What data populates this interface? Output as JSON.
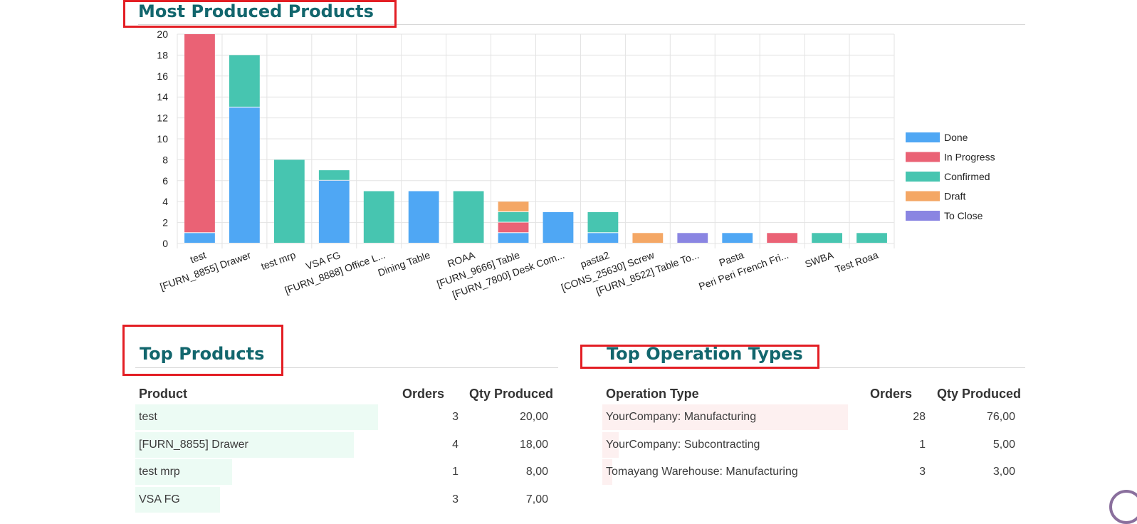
{
  "sections": {
    "most_produced": {
      "title": "Most Produced Products"
    },
    "top_products": {
      "title": "Top Products"
    },
    "top_operation_types": {
      "title": "Top Operation Types"
    }
  },
  "colors": {
    "title": "#12666d",
    "annotation_box": "#e31e24",
    "Done": "#4fa7f4",
    "In Progress": "#ea6275",
    "Confirmed": "#47c5b0",
    "Draft": "#f4a765",
    "To Close": "#8a85e2",
    "product_bar_bg": "#ecfbf4",
    "operation_bar_bg": "#fdf0f0"
  },
  "chart_data": {
    "type": "bar",
    "stacked": true,
    "title": "",
    "xlabel": "",
    "ylabel": "",
    "ylim": [
      0,
      20
    ],
    "y_ticks": [
      0,
      2,
      4,
      6,
      8,
      10,
      12,
      14,
      16,
      18,
      20
    ],
    "grid": true,
    "legend_position": "right",
    "categories": [
      "test",
      "[FURN_8855] Drawer",
      "test mrp",
      "VSA FG",
      "[FURN_8888] Office L...",
      "Dining Table",
      "ROAA",
      "[FURN_9666] Table",
      "[FURN_7800] Desk Com...",
      "pasta2",
      "[CONS_25630] Screw",
      "[FURN_8522] Table To...",
      "Pasta",
      "Peri Peri French Fri...",
      "SWBA",
      "Test Roaa"
    ],
    "series": [
      {
        "name": "Done",
        "values": [
          1,
          13,
          0,
          6,
          0,
          5,
          0,
          1,
          3,
          1,
          0,
          0,
          1,
          0,
          0,
          0
        ]
      },
      {
        "name": "In Progress",
        "values": [
          19,
          0,
          0,
          0,
          0,
          0,
          0,
          1,
          0,
          0,
          0,
          0,
          0,
          1,
          0,
          0
        ]
      },
      {
        "name": "Confirmed",
        "values": [
          0,
          5,
          8,
          1,
          5,
          0,
          5,
          1,
          0,
          2,
          0,
          0,
          0,
          0,
          1,
          1
        ]
      },
      {
        "name": "Draft",
        "values": [
          0,
          0,
          0,
          0,
          0,
          0,
          0,
          1,
          0,
          0,
          1,
          0,
          0,
          0,
          0,
          0
        ]
      },
      {
        "name": "To Close",
        "values": [
          0,
          0,
          0,
          0,
          0,
          0,
          0,
          0,
          0,
          0,
          0,
          1,
          0,
          0,
          0,
          0
        ]
      }
    ]
  },
  "top_products": {
    "headers": {
      "product": "Product",
      "orders": "Orders",
      "qty": "Qty Produced"
    },
    "rows": [
      {
        "product": "test",
        "orders": "3",
        "qty": "20,00",
        "share": 1.0
      },
      {
        "product": "[FURN_8855] Drawer",
        "orders": "4",
        "qty": "18,00",
        "share": 0.9
      },
      {
        "product": "test mrp",
        "orders": "1",
        "qty": "8,00",
        "share": 0.4
      },
      {
        "product": "VSA FG",
        "orders": "3",
        "qty": "7,00",
        "share": 0.35
      }
    ]
  },
  "top_operation_types": {
    "headers": {
      "operation": "Operation Type",
      "orders": "Orders",
      "qty": "Qty Produced"
    },
    "rows": [
      {
        "operation": "YourCompany: Manufacturing",
        "orders": "28",
        "qty": "76,00",
        "share": 1.0
      },
      {
        "operation": "YourCompany: Subcontracting",
        "orders": "1",
        "qty": "5,00",
        "share": 0.066
      },
      {
        "operation": "Tomayang Warehouse: Manufacturing",
        "orders": "3",
        "qty": "3,00",
        "share": 0.04
      }
    ]
  }
}
